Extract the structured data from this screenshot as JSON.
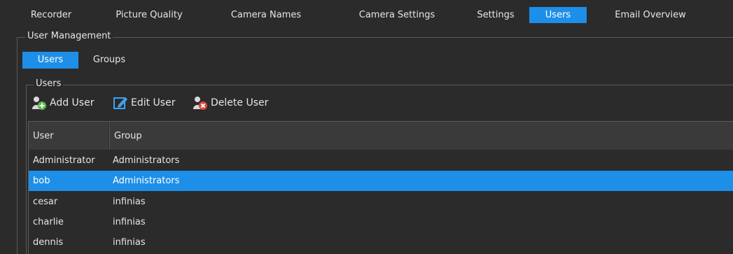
{
  "tabs": [
    {
      "label": "Recorder",
      "active": false
    },
    {
      "label": "Picture Quality",
      "active": false
    },
    {
      "label": "Camera Names",
      "active": false
    },
    {
      "label": "Camera Settings",
      "active": false
    },
    {
      "label": "Settings",
      "active": false
    },
    {
      "label": "Users",
      "active": true
    },
    {
      "label": "Email Overview",
      "active": false
    }
  ],
  "user_management": {
    "legend": "User Management",
    "subtabs": [
      {
        "label": "Users",
        "active": true
      },
      {
        "label": "Groups",
        "active": false
      }
    ],
    "users_group": {
      "legend": "Users",
      "toolbar": {
        "add_label": "Add User",
        "edit_label": "Edit User",
        "delete_label": "Delete User"
      },
      "table": {
        "columns": [
          "User",
          "Group"
        ],
        "rows": [
          {
            "user": "Administrator",
            "group": "Administrators",
            "selected": false
          },
          {
            "user": "bob",
            "group": "Administrators",
            "selected": true
          },
          {
            "user": "cesar",
            "group": "infinias",
            "selected": false
          },
          {
            "user": "charlie",
            "group": "infinias",
            "selected": false
          },
          {
            "user": "dennis",
            "group": "infinias",
            "selected": false
          }
        ]
      }
    }
  },
  "colors": {
    "accent": "#1e8fe8",
    "background": "#2b2b2b",
    "header": "#3a3a3a"
  },
  "icons": [
    "add-user-icon",
    "edit-user-icon",
    "delete-user-icon"
  ]
}
